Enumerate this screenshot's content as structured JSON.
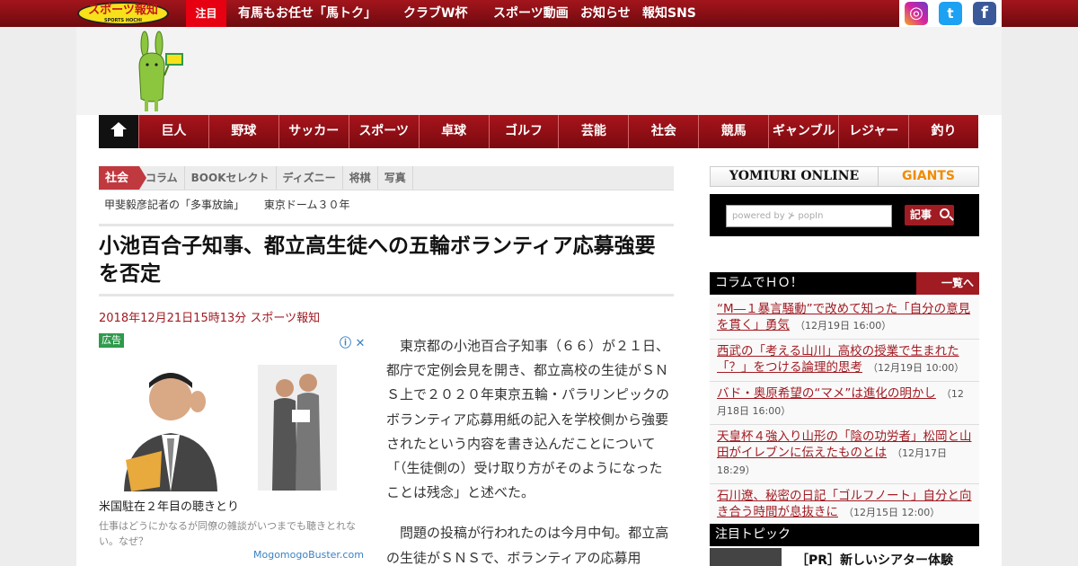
{
  "topbar": {
    "logo_text": "スポーツ報知",
    "logo_sub": "SPORTS HOCHI",
    "notice": "注目",
    "links": [
      "有馬もお任せ「馬トク」",
      "クラブW杯",
      "スポーツ動画",
      "お知らせ",
      "報知SNS"
    ],
    "social": [
      {
        "icon": "instagram-icon",
        "glyph": "◎"
      },
      {
        "icon": "twitter-icon",
        "glyph": "t"
      },
      {
        "icon": "facebook-icon",
        "glyph": "f"
      }
    ]
  },
  "nav": {
    "home_icon": "home-icon",
    "items": [
      "巨人",
      "野球",
      "サッカー",
      "スポーツ",
      "卓球",
      "ゴルフ",
      "芸能",
      "社会",
      "競馬",
      "ギャンブル",
      "レジャー",
      "釣り"
    ]
  },
  "subnav": {
    "active": "社会",
    "items": [
      "コラム",
      "BOOKセレクト",
      "ディズニー",
      "将棋",
      "写真"
    ],
    "sub_items": [
      "甲斐毅彦記者の「多事放論」",
      "東京ドーム３０年"
    ]
  },
  "article": {
    "headline": "小池百合子知事、都立高生徒への五輪ボランティア応募強要を否定",
    "dateline": "2018年12月21日15時13分  スポーツ報知",
    "paragraphs": [
      "東京都の小池百合子知事（６６）が２１日、都庁で定例会見を開き、都立高校の生徒がＳＮＳ上で２０２０年東京五輪・パラリンピックのボランティア応募用紙の記入を学校側から強要されたという内容を書き込んだことについて「（生徒側の）受け取り方がそのようになったことは残念」と述べた。",
      "問題の投稿が行われたのは今月中旬。都立高の生徒がＳＮＳで、ボランティアの応募用"
    ]
  },
  "ad": {
    "tag": "広告",
    "icons": "ⓘ ✕",
    "title": "米国駐在２年目の聴きとり",
    "desc": "仕事はどうにかなるが同僚の雑談がいつまでも聴きとれない。なぜ？",
    "source": "MogomogoBuster.com"
  },
  "sidebar": {
    "yomiuri": "YOMIURI ONLINE",
    "giants": "GIANTS",
    "search_placeholder": "powered by ⊁ popIn",
    "search_button": "記事",
    "column_title": "コラムでＨＯ！",
    "column_more": "一覧へ",
    "columns": [
      {
        "title": "“M―１暴言騒動”で改めて知った「自分の意見を貫く」勇気",
        "date": "（12月19日 16:00）"
      },
      {
        "title": "西武の「考える山川」高校の授業で生まれた「？」をつける論理的思考",
        "date": "（12月19日 10:00）"
      },
      {
        "title": "バド・奥原希望の“マメ”は進化の明かし",
        "date": "（12月18日 16:00）"
      },
      {
        "title": "天皇杯４強入り山形の「陰の功労者」松岡と山田がイレブンに伝えたものとは",
        "date": "（12月17日 18:29）"
      },
      {
        "title": "石川遼、秘密の日記「ゴルフノート」自分と向き合う時間が息抜きに",
        "date": "（12月15日 12:00）"
      }
    ],
    "topic_title": "注目トピック",
    "topic_item": "［PR］新しいシアター体験"
  }
}
